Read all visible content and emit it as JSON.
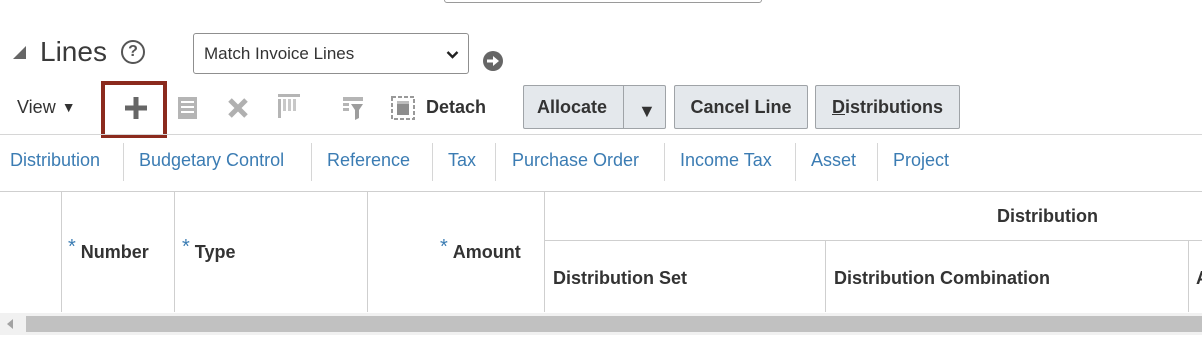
{
  "section": {
    "title": "Lines",
    "help_glyph": "?",
    "view_select": {
      "value": "Match Invoice Lines"
    }
  },
  "toolbar": {
    "view_label": "View",
    "view_caret": "▼",
    "detach_label": "Detach",
    "allocate_label": "Allocate",
    "allocate_caret": "▼",
    "cancel_line_label": "Cancel Line",
    "distributions_label_underlined": "D",
    "distributions_label_rest": "istributions"
  },
  "tabs": [
    {
      "label": "Distribution"
    },
    {
      "label": "Budgetary Control"
    },
    {
      "label": "Reference"
    },
    {
      "label": "Tax"
    },
    {
      "label": "Purchase Order"
    },
    {
      "label": "Income Tax"
    },
    {
      "label": "Asset"
    },
    {
      "label": "Project"
    }
  ],
  "table": {
    "required_marker": "*",
    "columns": {
      "number": "Number",
      "type": "Type",
      "amount": "Amount",
      "group_distribution": "Distribution",
      "distribution_set": "Distribution Set",
      "distribution_combination": "Distribution Combination",
      "partial_next": "A"
    }
  },
  "colors": {
    "accent_link": "#3b7cb3",
    "highlight_box": "#8b2a1d",
    "button_bg": "#e4e8ec"
  },
  "icons": {
    "collapse": "triangle-down-left-icon",
    "help": "help-circle-icon",
    "go": "go-arrow-icon",
    "add": "plus-icon",
    "edit": "edit-list-icon",
    "delete": "close-icon",
    "freeze": "freeze-columns-icon",
    "query_by_example": "filter-icon",
    "detach": "detach-icon"
  }
}
